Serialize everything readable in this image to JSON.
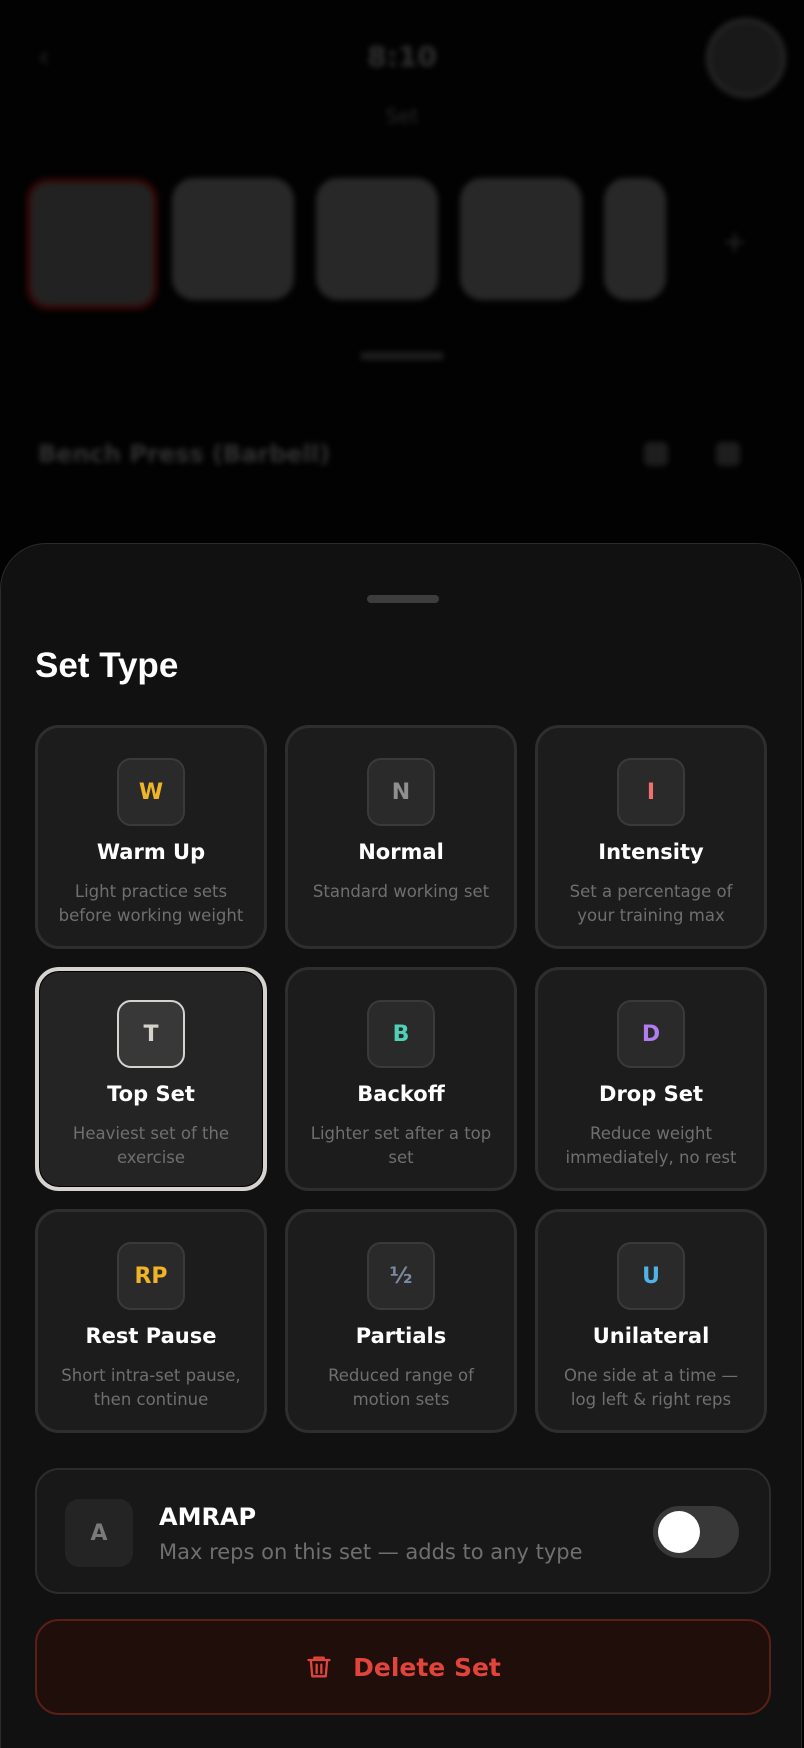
{
  "background": {
    "time": "8:10",
    "subtitle": "Set",
    "exercise_title": "Bench Press (Barbell)",
    "back_glyph": "‹",
    "add_glyph": "+"
  },
  "sheet": {
    "title": "Set Type",
    "set_types": [
      {
        "code": "W",
        "title": "Warm Up",
        "description": "Light practice sets before working weight",
        "color": "#f0b429",
        "selected": false
      },
      {
        "code": "N",
        "title": "Normal",
        "description": "Standard working set",
        "color": "#8f8f8f",
        "selected": false
      },
      {
        "code": "I",
        "title": "Intensity",
        "description": "Set a percentage of your training max",
        "color": "#f07070",
        "selected": false
      },
      {
        "code": "T",
        "title": "Top Set",
        "description": "Heaviest set of the exercise",
        "color": "#d6d3cf",
        "selected": true
      },
      {
        "code": "B",
        "title": "Backoff",
        "description": "Lighter set after a top set",
        "color": "#4fd1b5",
        "selected": false
      },
      {
        "code": "D",
        "title": "Drop Set",
        "description": "Reduce weight immediately, no rest",
        "color": "#b07cf0",
        "selected": false
      },
      {
        "code": "RP",
        "title": "Rest Pause",
        "description": "Short intra-set pause, then continue",
        "color": "#f0b429",
        "selected": false
      },
      {
        "code": "½",
        "title": "Partials",
        "description": "Reduced range of motion sets",
        "color": "#7c8aa0",
        "selected": false
      },
      {
        "code": "U",
        "title": "Unilateral",
        "description": "One side at a time — log left & right reps",
        "color": "#4fb3e8",
        "selected": false
      }
    ],
    "amrap": {
      "code": "A",
      "title": "AMRAP",
      "description": "Max reps on this set — adds to any type",
      "enabled": false
    },
    "delete_label": "Delete Set"
  },
  "colors": {
    "sheet_bg": "#111111",
    "card_bg": "#1c1c1c",
    "selected_border": "#d6d3cf",
    "delete_text": "#e0443a",
    "delete_bg": "#1f0e0a"
  }
}
